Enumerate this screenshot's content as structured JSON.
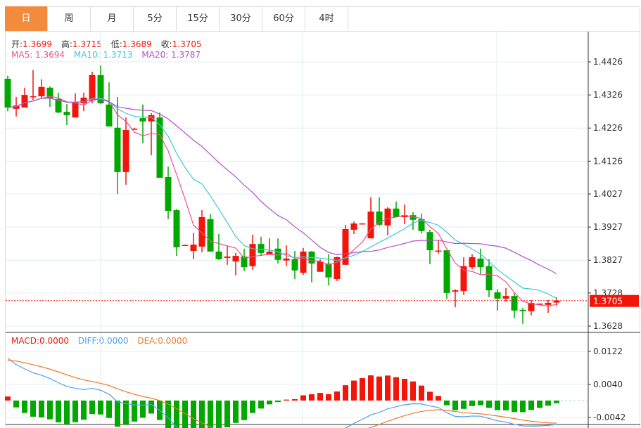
{
  "tabs": [
    {
      "label": "日",
      "active": true
    },
    {
      "label": "周"
    },
    {
      "label": "月"
    },
    {
      "label": "5分"
    },
    {
      "label": "15分"
    },
    {
      "label": "30分"
    },
    {
      "label": "60分"
    },
    {
      "label": "4时"
    }
  ],
  "legend": {
    "open_label": "开:",
    "open": "1.3699",
    "high_label": "高:",
    "high": "1.3715",
    "low_label": "低:",
    "low": "1.3689",
    "close_label": "收:",
    "close": "1.3705",
    "ma5": "MA5: 1.3694",
    "ma10": "MA10: 1.3713",
    "ma20": "MA20: 1.3787"
  },
  "macd_legend": {
    "macd": "MACD:0.0000",
    "diff": "DIFF:0.0000",
    "dea": "DEA:0.0000"
  },
  "colors": {
    "up": "#f3140a",
    "down": "#00a800",
    "ma5": "#f0508c",
    "ma10": "#3cc8dc",
    "ma20": "#b450c8",
    "diff": "#50a0e6",
    "dea": "#f07828",
    "accent": "#f28c3c"
  },
  "current_price": "1.3705",
  "chart_data": {
    "type": "candlestick",
    "price_axis": {
      "ticks": [
        "1.4426",
        "1.4326",
        "1.4226",
        "1.4126",
        "1.4027",
        "1.3927",
        "1.3827",
        "1.3728",
        "1.3628"
      ],
      "range": [
        1.3628,
        1.4426
      ]
    },
    "macd_axis": {
      "ticks": [
        "0.0122",
        "0.0040",
        "-0.0042"
      ],
      "range": [
        -0.0042,
        0.0122
      ]
    },
    "macd_seed": {
      "diff": 0.0105,
      "dea": 0.01
    },
    "candles": [
      [
        1.4375,
        1.4384,
        1.4277,
        1.4288
      ],
      [
        1.4284,
        1.432,
        1.4261,
        1.4294
      ],
      [
        1.4288,
        1.4348,
        1.4288,
        1.4326
      ],
      [
        1.432,
        1.4401,
        1.4311,
        1.4322
      ],
      [
        1.4322,
        1.4373,
        1.4314,
        1.435
      ],
      [
        1.4348,
        1.4352,
        1.429,
        1.4316
      ],
      [
        1.4314,
        1.4333,
        1.4271,
        1.4273
      ],
      [
        1.4275,
        1.4299,
        1.4235,
        1.4265
      ],
      [
        1.4258,
        1.4331,
        1.4258,
        1.4305
      ],
      [
        1.4301,
        1.4333,
        1.4277,
        1.4318
      ],
      [
        1.4309,
        1.4396,
        1.4301,
        1.4386
      ],
      [
        1.4386,
        1.4415,
        1.4299,
        1.4301
      ],
      [
        1.4297,
        1.4364,
        1.4231,
        1.4231
      ],
      [
        1.4227,
        1.432,
        1.4027,
        1.4093
      ],
      [
        1.4093,
        1.4258,
        1.4055,
        1.422
      ],
      [
        1.4223,
        1.4227,
        1.4222,
        1.4224
      ],
      [
        1.4256,
        1.4297,
        1.418,
        1.4246
      ],
      [
        1.4246,
        1.4271,
        1.4144,
        1.4265
      ],
      [
        1.4258,
        1.4273,
        1.4076,
        1.4076
      ],
      [
        1.4078,
        1.411,
        1.3951,
        1.3976
      ],
      [
        1.3978,
        1.3982,
        1.384,
        1.3866
      ],
      [
        1.3872,
        1.3874,
        1.387,
        1.3873
      ],
      [
        1.3855,
        1.391,
        1.383,
        1.3874
      ],
      [
        1.3868,
        1.3978,
        1.3851,
        1.3957
      ],
      [
        1.3951,
        1.3966,
        1.3853,
        1.3853
      ],
      [
        1.3853,
        1.3906,
        1.3828,
        1.383
      ],
      [
        1.3834,
        1.387,
        1.3813,
        1.3838
      ],
      [
        1.3823,
        1.3849,
        1.3781,
        1.384
      ],
      [
        1.3838,
        1.3862,
        1.3794,
        1.3806
      ],
      [
        1.3809,
        1.3904,
        1.3798,
        1.3876
      ],
      [
        1.3876,
        1.3898,
        1.384,
        1.3849
      ],
      [
        1.3845,
        1.3893,
        1.3845,
        1.3853
      ],
      [
        1.3862,
        1.3893,
        1.3817,
        1.3828
      ],
      [
        1.3826,
        1.3872,
        1.3809,
        1.3832
      ],
      [
        1.383,
        1.3855,
        1.377,
        1.3796
      ],
      [
        1.3789,
        1.3864,
        1.3783,
        1.3853
      ],
      [
        1.3853,
        1.3855,
        1.376,
        1.3817
      ],
      [
        1.3792,
        1.383,
        1.3792,
        1.3823
      ],
      [
        1.3817,
        1.3845,
        1.3751,
        1.3775
      ],
      [
        1.377,
        1.3838,
        1.3764,
        1.3836
      ],
      [
        1.3813,
        1.3934,
        1.3813,
        1.3921
      ],
      [
        1.3919,
        1.3944,
        1.3906,
        1.3938
      ],
      [
        1.3937,
        1.3939,
        1.3936,
        1.3938
      ],
      [
        1.3893,
        1.4017,
        1.3893,
        1.3974
      ],
      [
        1.3974,
        1.4017,
        1.393,
        1.3934
      ],
      [
        1.3932,
        1.3987,
        1.3902,
        1.3983
      ],
      [
        1.3983,
        1.4004,
        1.3957,
        1.3957
      ],
      [
        1.3957,
        1.3995,
        1.3936,
        1.3963
      ],
      [
        1.3963,
        1.3972,
        1.3919,
        1.3949
      ],
      [
        1.3951,
        1.3968,
        1.3908,
        1.3915
      ],
      [
        1.3912,
        1.3919,
        1.3815,
        1.3857
      ],
      [
        1.3855,
        1.3887,
        1.3847,
        1.3856
      ],
      [
        1.3857,
        1.3857,
        1.3709,
        1.3728
      ],
      [
        1.3732,
        1.3739,
        1.3685,
        1.3736
      ],
      [
        1.3734,
        1.3836,
        1.3722,
        1.3809
      ],
      [
        1.3806,
        1.3845,
        1.38,
        1.3836
      ],
      [
        1.3832,
        1.3862,
        1.3785,
        1.3806
      ],
      [
        1.3809,
        1.383,
        1.3715,
        1.3736
      ],
      [
        1.373,
        1.3739,
        1.3675,
        1.3711
      ],
      [
        1.3711,
        1.3743,
        1.3702,
        1.3719
      ],
      [
        1.3719,
        1.3728,
        1.3652,
        1.3675
      ],
      [
        1.3677,
        1.3683,
        1.3635,
        1.3673
      ],
      [
        1.3673,
        1.3707,
        1.366,
        1.3698
      ],
      [
        1.3694,
        1.3696,
        1.3692,
        1.3696
      ],
      [
        1.3692,
        1.3707,
        1.3668,
        1.3698
      ],
      [
        1.3699,
        1.3715,
        1.3689,
        1.3705
      ]
    ]
  }
}
